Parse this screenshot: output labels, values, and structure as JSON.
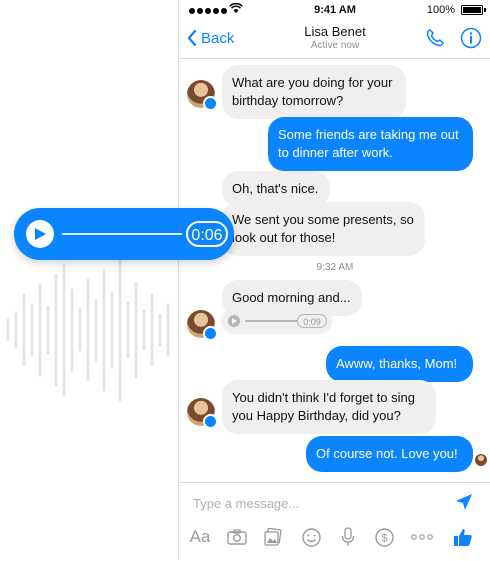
{
  "status_bar": {
    "time": "9:41 AM",
    "battery": "100%"
  },
  "header": {
    "back_label": "Back",
    "contact_name": "Lisa Benet",
    "contact_status": "Active now"
  },
  "voice_overlay": {
    "duration": "0:06"
  },
  "messages": [
    {
      "from": "them",
      "text": "What are you doing for your birthday tomorrow?"
    },
    {
      "from": "me",
      "text": "Some friends are taking me out to dinner after work."
    },
    {
      "from": "them",
      "text": "Oh, that's nice."
    },
    {
      "from": "them",
      "text": "We sent you some presents, so look out for those!"
    },
    {
      "from": "them",
      "text": "Good morning and..."
    },
    {
      "from": "them",
      "type": "audio",
      "duration": "0:09"
    },
    {
      "from": "me",
      "text": "Awww, thanks, Mom!"
    },
    {
      "from": "them",
      "text": "You didn't think I'd forget to sing you Happy Birthday, did you?"
    },
    {
      "from": "me",
      "text": "Of course not. Love you!"
    }
  ],
  "timestamp": "9:32 AM",
  "composer": {
    "placeholder": "Type a message...",
    "toolbar": [
      "Aa",
      "camera-icon",
      "photos-icon",
      "emoji-icon",
      "microphone-icon",
      "payment-icon",
      "more-icon",
      "like-icon"
    ]
  },
  "colors": {
    "accent": "#0a84ff",
    "incoming_bubble": "#efefef"
  }
}
